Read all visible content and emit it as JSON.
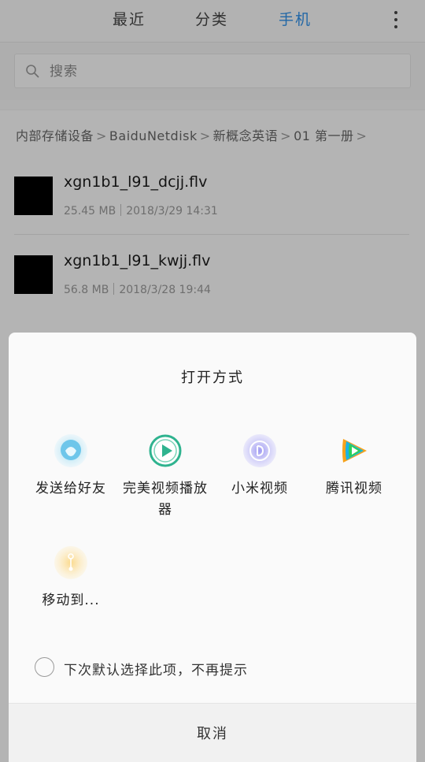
{
  "tabs": [
    {
      "label": "最近"
    },
    {
      "label": "分类"
    },
    {
      "label": "手机"
    }
  ],
  "colors": {
    "active_tab": "#2f8fe6"
  },
  "search": {
    "placeholder": "搜索"
  },
  "breadcrumb": [
    "内部存储设备",
    "BaiduNetdisk",
    "新概念英语",
    "01 第一册"
  ],
  "files": [
    {
      "name": "xgn1b1_l91_dcjj.flv",
      "size": "25.45 MB",
      "date": "2018/3/29 14:31"
    },
    {
      "name": "xgn1b1_l91_kwjj.flv",
      "size": "56.8 MB",
      "date": "2018/3/28 19:44"
    }
  ],
  "dialog": {
    "title": "打开方式",
    "apps": [
      {
        "label": "发送给好友",
        "icon": "qq-icon"
      },
      {
        "label": "完美视频播放器",
        "icon": "perfect-player-icon"
      },
      {
        "label": "小米视频",
        "icon": "mi-video-icon"
      },
      {
        "label": "腾讯视频",
        "icon": "tencent-video-icon"
      },
      {
        "label": "移动到...",
        "icon": "move-to-icon"
      }
    ],
    "remember_option": "下次默认选择此项，不再提示",
    "cancel_label": "取消"
  }
}
